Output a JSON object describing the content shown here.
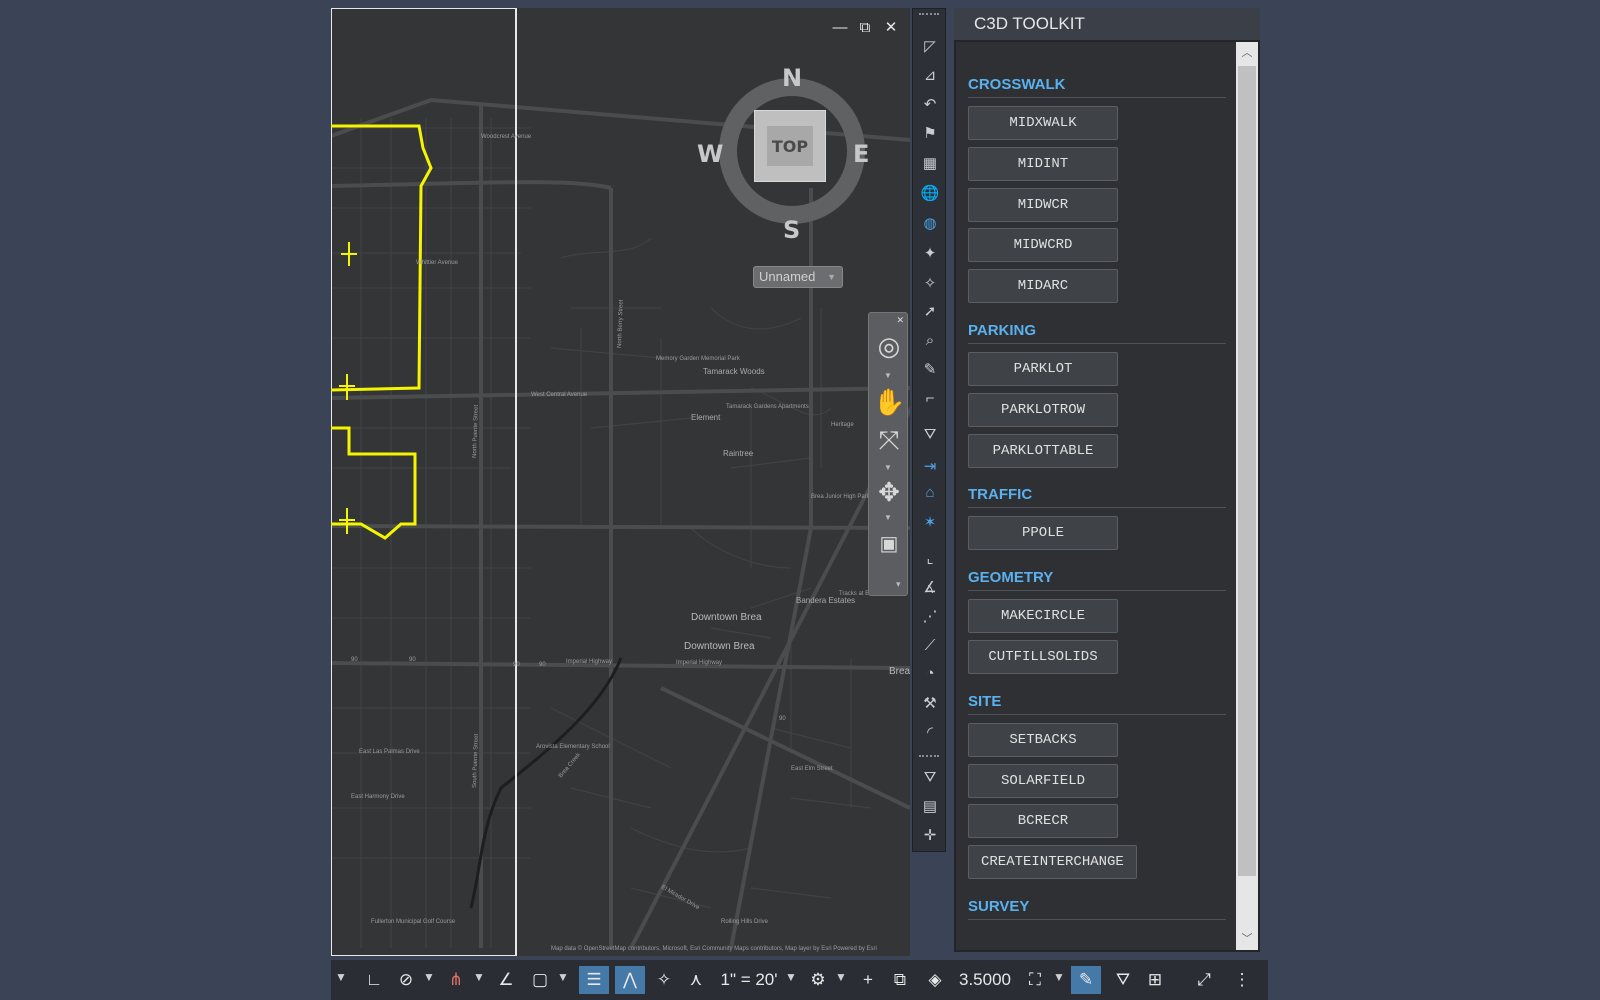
{
  "window_controls": {
    "minimize_icon": "—",
    "restore_icon": "⧉",
    "close_icon": "✕"
  },
  "viewcube": {
    "north": "N",
    "south": "S",
    "east": "E",
    "west": "W",
    "face": "TOP"
  },
  "ucs_dropdown": {
    "value": "Unnamed"
  },
  "map": {
    "attribution": "Map data © OpenStreetMap contributors, Microsoft, Esri Community Maps contributors, Map layer by Esri Powered by Esri",
    "labels": {
      "downtown_brea_1": "Downtown Brea",
      "downtown_brea_2": "Downtown Brea",
      "brea": "Brea",
      "west_central": "West Central Avenue",
      "imperial_hwy": "Imperial Highway",
      "imperial_hwy_2": "Imperial Highway",
      "tamarack_woods": "Tamarack Woods",
      "tamarack_apts": "Tamarack Gardens Apartments",
      "element": "Element",
      "raintree": "Raintree",
      "memory_garden": "Memory Garden Memorial Park",
      "brea_junior": "Brea Junior High Park",
      "bandera": "Bandera Estates",
      "arovista": "Arovista Elementary School",
      "east_elm": "East Elm Street",
      "north_berry": "North Berry Street",
      "south_puente": "South Puente Street",
      "north_puente": "North Puente Street",
      "whittier": "Whittier Avenue",
      "brea_creek": "Brea Creek",
      "east_las_palmas": "East Las Palmas Drive",
      "east_harmony": "East Harmony Drive",
      "rolling_hills": "Rolling Hills Drive",
      "fullerton_golf": "Fullerton Municipal Golf Course",
      "tracks_at_brea": "Tracks at Brea",
      "heritage": "Heritage",
      "woodcrest": "Woodcrest Avenue",
      "el_mirador": "El Mirador Drive",
      "elm_street_label": "East Elm Street",
      "route_90_a": "90",
      "route_90_b": "90",
      "route_90_c": "90",
      "route_90_d": "90",
      "route_90_e": "90"
    }
  },
  "palette": {
    "title": "C3D TOOLKIT",
    "sections": [
      {
        "title": "CROSSWALK",
        "buttons": [
          "MIDXWALK",
          "MIDINT",
          "MIDWCR",
          "MIDWCRD",
          "MIDARC"
        ]
      },
      {
        "title": "PARKING",
        "buttons": [
          "PARKLOT",
          "PARKLOTROW",
          "PARKLOTTABLE"
        ]
      },
      {
        "title": "TRAFFIC",
        "buttons": [
          "PPOLE"
        ]
      },
      {
        "title": "GEOMETRY",
        "buttons": [
          "MAKECIRCLE",
          "CUTFILLSOLIDS"
        ]
      },
      {
        "title": "SITE",
        "buttons": [
          "SETBACKS",
          "SOLARFIELD",
          "BCRECR",
          "CREATEINTERCHANGE"
        ]
      },
      {
        "title": "SURVEY",
        "buttons": []
      }
    ]
  },
  "statusbar": {
    "scale": "1\" = 20'",
    "lineweight": "3.5000"
  },
  "colors": {
    "accent": "#5ab1ee",
    "active_toggle": "#4579a8",
    "boundary": "#f5f500"
  }
}
